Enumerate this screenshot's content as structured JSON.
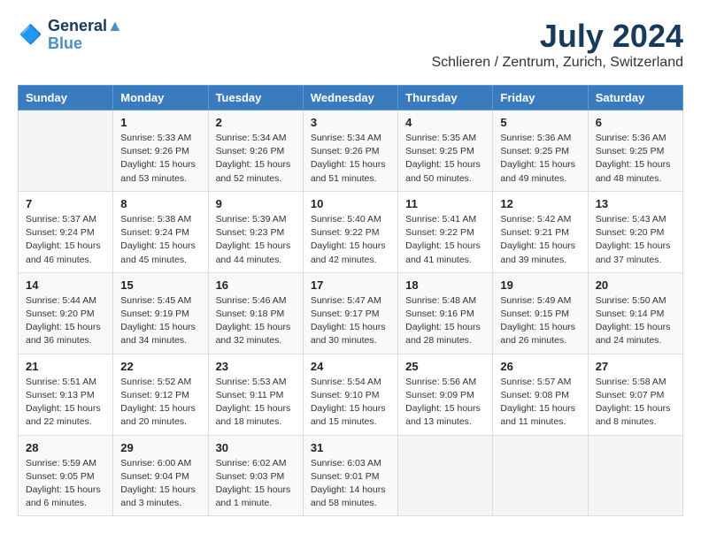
{
  "logo": {
    "line1": "General",
    "line2": "Blue"
  },
  "title": "July 2024",
  "location": "Schlieren / Zentrum, Zurich, Switzerland",
  "days_of_week": [
    "Sunday",
    "Monday",
    "Tuesday",
    "Wednesday",
    "Thursday",
    "Friday",
    "Saturday"
  ],
  "weeks": [
    [
      {
        "day": "",
        "info": ""
      },
      {
        "day": "1",
        "info": "Sunrise: 5:33 AM\nSunset: 9:26 PM\nDaylight: 15 hours\nand 53 minutes."
      },
      {
        "day": "2",
        "info": "Sunrise: 5:34 AM\nSunset: 9:26 PM\nDaylight: 15 hours\nand 52 minutes."
      },
      {
        "day": "3",
        "info": "Sunrise: 5:34 AM\nSunset: 9:26 PM\nDaylight: 15 hours\nand 51 minutes."
      },
      {
        "day": "4",
        "info": "Sunrise: 5:35 AM\nSunset: 9:25 PM\nDaylight: 15 hours\nand 50 minutes."
      },
      {
        "day": "5",
        "info": "Sunrise: 5:36 AM\nSunset: 9:25 PM\nDaylight: 15 hours\nand 49 minutes."
      },
      {
        "day": "6",
        "info": "Sunrise: 5:36 AM\nSunset: 9:25 PM\nDaylight: 15 hours\nand 48 minutes."
      }
    ],
    [
      {
        "day": "7",
        "info": "Sunrise: 5:37 AM\nSunset: 9:24 PM\nDaylight: 15 hours\nand 46 minutes."
      },
      {
        "day": "8",
        "info": "Sunrise: 5:38 AM\nSunset: 9:24 PM\nDaylight: 15 hours\nand 45 minutes."
      },
      {
        "day": "9",
        "info": "Sunrise: 5:39 AM\nSunset: 9:23 PM\nDaylight: 15 hours\nand 44 minutes."
      },
      {
        "day": "10",
        "info": "Sunrise: 5:40 AM\nSunset: 9:22 PM\nDaylight: 15 hours\nand 42 minutes."
      },
      {
        "day": "11",
        "info": "Sunrise: 5:41 AM\nSunset: 9:22 PM\nDaylight: 15 hours\nand 41 minutes."
      },
      {
        "day": "12",
        "info": "Sunrise: 5:42 AM\nSunset: 9:21 PM\nDaylight: 15 hours\nand 39 minutes."
      },
      {
        "day": "13",
        "info": "Sunrise: 5:43 AM\nSunset: 9:20 PM\nDaylight: 15 hours\nand 37 minutes."
      }
    ],
    [
      {
        "day": "14",
        "info": "Sunrise: 5:44 AM\nSunset: 9:20 PM\nDaylight: 15 hours\nand 36 minutes."
      },
      {
        "day": "15",
        "info": "Sunrise: 5:45 AM\nSunset: 9:19 PM\nDaylight: 15 hours\nand 34 minutes."
      },
      {
        "day": "16",
        "info": "Sunrise: 5:46 AM\nSunset: 9:18 PM\nDaylight: 15 hours\nand 32 minutes."
      },
      {
        "day": "17",
        "info": "Sunrise: 5:47 AM\nSunset: 9:17 PM\nDaylight: 15 hours\nand 30 minutes."
      },
      {
        "day": "18",
        "info": "Sunrise: 5:48 AM\nSunset: 9:16 PM\nDaylight: 15 hours\nand 28 minutes."
      },
      {
        "day": "19",
        "info": "Sunrise: 5:49 AM\nSunset: 9:15 PM\nDaylight: 15 hours\nand 26 minutes."
      },
      {
        "day": "20",
        "info": "Sunrise: 5:50 AM\nSunset: 9:14 PM\nDaylight: 15 hours\nand 24 minutes."
      }
    ],
    [
      {
        "day": "21",
        "info": "Sunrise: 5:51 AM\nSunset: 9:13 PM\nDaylight: 15 hours\nand 22 minutes."
      },
      {
        "day": "22",
        "info": "Sunrise: 5:52 AM\nSunset: 9:12 PM\nDaylight: 15 hours\nand 20 minutes."
      },
      {
        "day": "23",
        "info": "Sunrise: 5:53 AM\nSunset: 9:11 PM\nDaylight: 15 hours\nand 18 minutes."
      },
      {
        "day": "24",
        "info": "Sunrise: 5:54 AM\nSunset: 9:10 PM\nDaylight: 15 hours\nand 15 minutes."
      },
      {
        "day": "25",
        "info": "Sunrise: 5:56 AM\nSunset: 9:09 PM\nDaylight: 15 hours\nand 13 minutes."
      },
      {
        "day": "26",
        "info": "Sunrise: 5:57 AM\nSunset: 9:08 PM\nDaylight: 15 hours\nand 11 minutes."
      },
      {
        "day": "27",
        "info": "Sunrise: 5:58 AM\nSunset: 9:07 PM\nDaylight: 15 hours\nand 8 minutes."
      }
    ],
    [
      {
        "day": "28",
        "info": "Sunrise: 5:59 AM\nSunset: 9:05 PM\nDaylight: 15 hours\nand 6 minutes."
      },
      {
        "day": "29",
        "info": "Sunrise: 6:00 AM\nSunset: 9:04 PM\nDaylight: 15 hours\nand 3 minutes."
      },
      {
        "day": "30",
        "info": "Sunrise: 6:02 AM\nSunset: 9:03 PM\nDaylight: 15 hours\nand 1 minute."
      },
      {
        "day": "31",
        "info": "Sunrise: 6:03 AM\nSunset: 9:01 PM\nDaylight: 14 hours\nand 58 minutes."
      },
      {
        "day": "",
        "info": ""
      },
      {
        "day": "",
        "info": ""
      },
      {
        "day": "",
        "info": ""
      }
    ]
  ]
}
